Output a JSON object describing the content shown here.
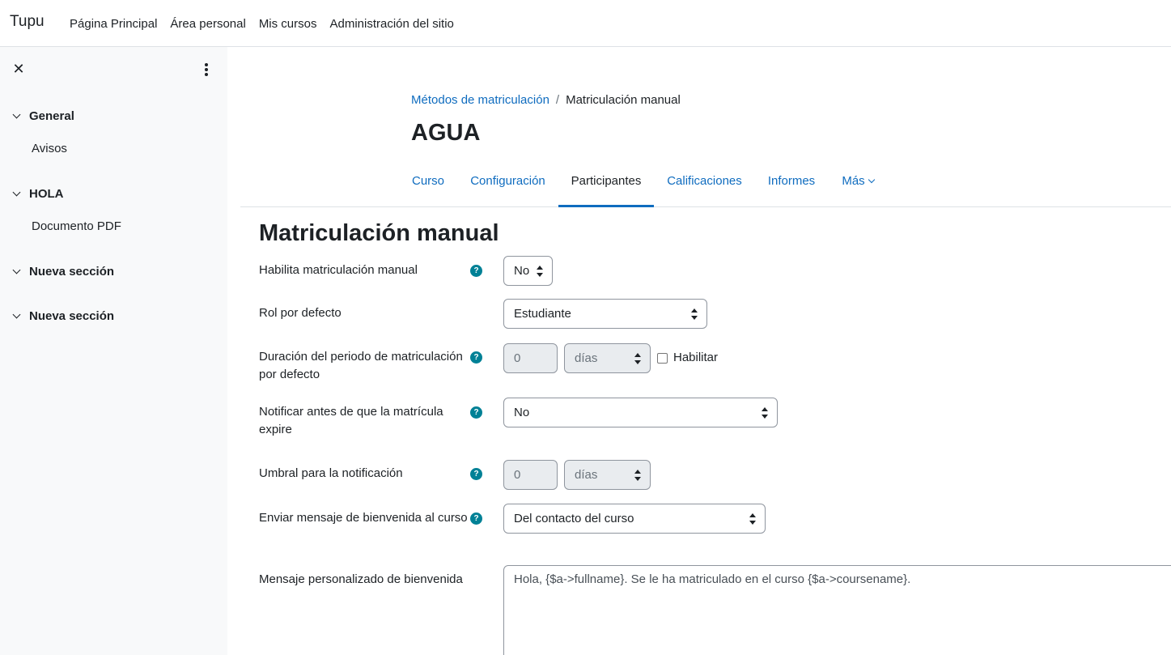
{
  "navbar": {
    "brand": "Tupu",
    "links": [
      "Página Principal",
      "Área personal",
      "Mis cursos",
      "Administración del sitio"
    ]
  },
  "drawer": {
    "close_icon": "close-icon",
    "menu_icon": "kebab-menu-icon",
    "sections": [
      {
        "title": "General",
        "items": [
          "Avisos"
        ]
      },
      {
        "title": "HOLA",
        "items": [
          "Documento PDF"
        ]
      },
      {
        "title": "Nueva sección",
        "items": []
      },
      {
        "title": "Nueva sección",
        "items": []
      }
    ]
  },
  "breadcrumb": {
    "parent": "Métodos de matriculación",
    "separator": "/",
    "current": "Matriculación manual"
  },
  "course_title": "AGUA",
  "tabs": {
    "items": [
      "Curso",
      "Configuración",
      "Participantes",
      "Calificaciones",
      "Informes",
      "Más"
    ],
    "active": "Participantes"
  },
  "page_heading": "Matriculación manual",
  "form": {
    "enable": {
      "label": "Habilita matriculación manual",
      "value": "No"
    },
    "role": {
      "label": "Rol por defecto",
      "value": "Estudiante"
    },
    "duration": {
      "label": "Duración del periodo de matriculación por defecto",
      "number": "0",
      "unit": "días",
      "checkbox_label": "Habilitar",
      "checked": false
    },
    "notify": {
      "label": "Notificar antes de que la matrícula expire",
      "value": "No"
    },
    "threshold": {
      "label": "Umbral para la notificación",
      "number": "0",
      "unit": "días"
    },
    "welcome": {
      "label": "Enviar mensaje de bienvenida al curso",
      "value": "Del contacto del curso"
    },
    "custom_message": {
      "label": "Mensaje personalizado de bienvenida",
      "value": "Hola, {$a->fullname}. Se le ha matriculado en el curso {$a->coursename}."
    },
    "help_icon_glyph": "?"
  },
  "colors": {
    "link": "#0f6cbf",
    "help": "#008196",
    "drawer_bg": "#f8f9fa"
  }
}
